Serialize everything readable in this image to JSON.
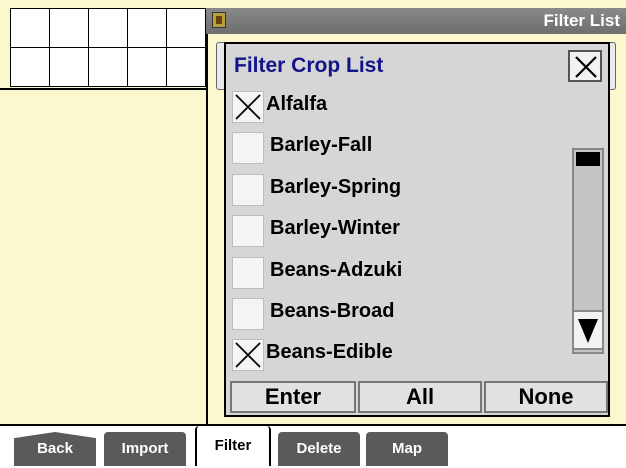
{
  "window": {
    "title": "Filter List"
  },
  "dialog": {
    "title": "Filter Crop List",
    "items": [
      {
        "label": "Alfalfa",
        "checked": true
      },
      {
        "label": "Barley-Fall",
        "checked": false
      },
      {
        "label": "Barley-Spring",
        "checked": false
      },
      {
        "label": "Barley-Winter",
        "checked": false
      },
      {
        "label": "Beans-Adzuki",
        "checked": false
      },
      {
        "label": "Beans-Broad",
        "checked": false
      },
      {
        "label": "Beans-Edible",
        "checked": true
      }
    ],
    "buttons": {
      "enter": "Enter",
      "all": "All",
      "none": "None"
    }
  },
  "tabs": [
    {
      "label": "Back"
    },
    {
      "label": "Import"
    },
    {
      "label": "Filter",
      "active": true
    },
    {
      "label": "Delete"
    },
    {
      "label": "Map"
    }
  ],
  "colors": {
    "background": "#fbf7cf",
    "titlebar": "#7a7a7a",
    "dialog_title": "#14148a",
    "tab": "#5a5a5a"
  },
  "icons": {
    "title": "app-icon",
    "close": "close-icon",
    "check": "check-x-icon",
    "scroll_down": "arrow-down-icon"
  }
}
